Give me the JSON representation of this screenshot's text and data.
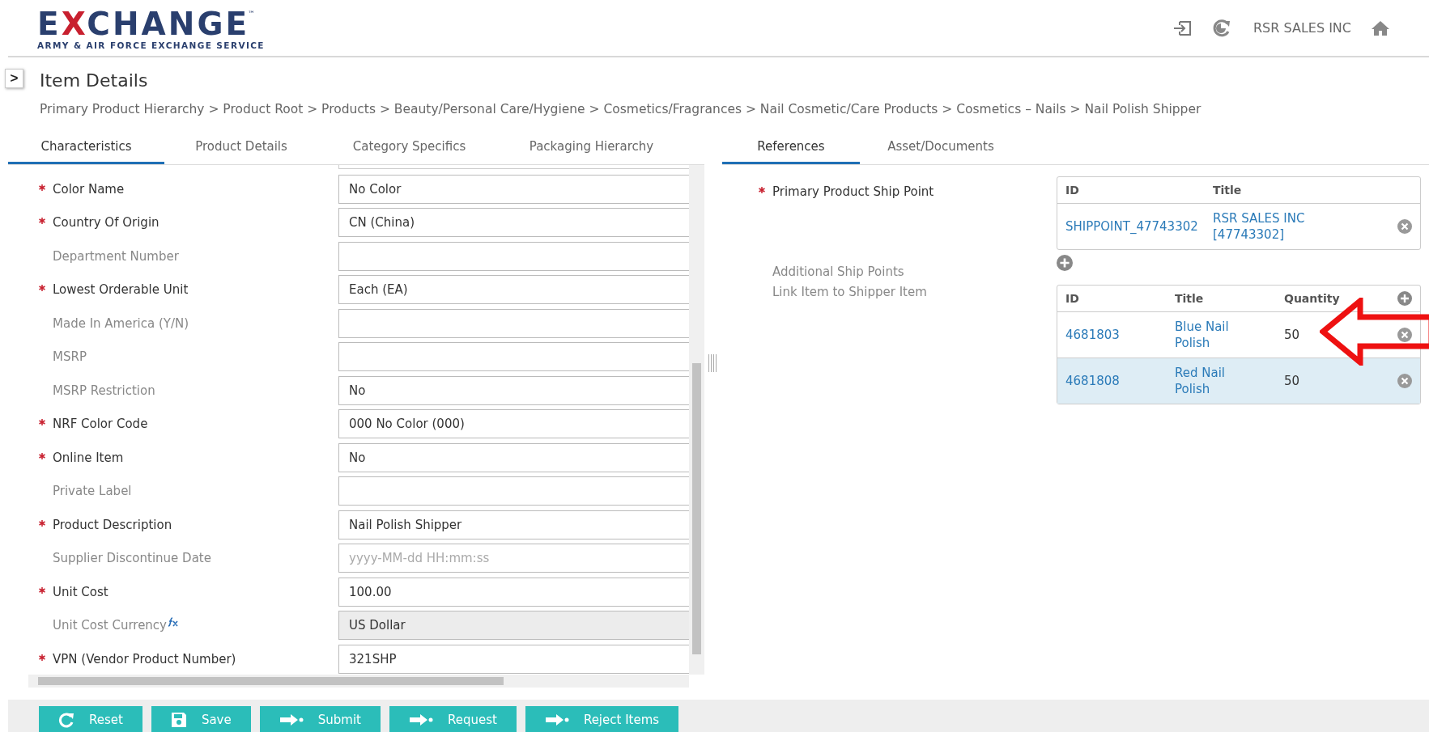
{
  "header": {
    "logo": {
      "lead": "E",
      "accent": "X",
      "rest": "CHANGE",
      "trademark": "™",
      "subtitle": "ARMY & AIR FORCE EXCHANGE SERVICE"
    },
    "user": "RSR SALES INC"
  },
  "sidebar_toggle": ">",
  "page": {
    "title": "Item Details",
    "breadcrumb": "Primary Product Hierarchy > Product Root > Products > Beauty/Personal Care/Hygiene > Cosmetics/Fragrances > Nail Cosmetic/Care Products > Cosmetics – Nails > Nail Polish Shipper"
  },
  "left_tabs": [
    {
      "label": "Characteristics",
      "selected": true
    },
    {
      "label": "Product Details",
      "selected": false
    },
    {
      "label": "Category Specifics",
      "selected": false
    },
    {
      "label": "Packaging Hierarchy",
      "selected": false
    }
  ],
  "fields": [
    {
      "label": "Color Name",
      "required": true,
      "value": "No Color"
    },
    {
      "label": "Country Of Origin",
      "required": true,
      "value": "CN (China)"
    },
    {
      "label": "Department Number",
      "required": false
    },
    {
      "label": "Lowest Orderable Unit",
      "required": true,
      "value": "Each (EA)"
    },
    {
      "label": "Made In America (Y/N)",
      "required": false
    },
    {
      "label": "MSRP",
      "required": false
    },
    {
      "label": "MSRP Restriction",
      "required": false,
      "value": "No"
    },
    {
      "label": "NRF Color Code",
      "required": true,
      "value": "000 No Color (000)"
    },
    {
      "label": "Online Item",
      "required": true,
      "value": "No"
    },
    {
      "label": "Private Label",
      "required": false
    },
    {
      "label": "Product Description",
      "required": true,
      "value": "Nail Polish Shipper"
    },
    {
      "label": "Supplier Discontinue Date",
      "required": false,
      "placeholder": "yyyy-MM-dd HH:mm:ss"
    },
    {
      "label": "Unit Cost",
      "required": true,
      "value": "100.00"
    },
    {
      "label": "Unit Cost Currency",
      "required": false,
      "formula": true,
      "value": "US Dollar",
      "disabled": true
    },
    {
      "label": "VPN (Vendor Product Number)",
      "required": true,
      "value": "321SHP"
    }
  ],
  "right_tabs": [
    {
      "label": "References",
      "selected": true
    },
    {
      "label": "Asset/Documents",
      "selected": false
    }
  ],
  "references": {
    "primary_ship_point": {
      "label": "Primary Product Ship Point",
      "required": true,
      "columns": [
        "ID",
        "Title"
      ],
      "rows": [
        {
          "id": "SHIPPOINT_47743302",
          "title": "RSR SALES INC [47743302]"
        }
      ]
    },
    "additional_ship_points": {
      "label": "Additional Ship Points"
    },
    "shipper_items": {
      "label": "Link Item to Shipper Item",
      "columns": [
        "ID",
        "Title",
        "Quantity"
      ],
      "rows": [
        {
          "id": "4681803",
          "title": "Blue Nail Polish",
          "quantity": "50",
          "selected": false
        },
        {
          "id": "4681808",
          "title": "Red Nail Polish",
          "quantity": "50",
          "selected": true
        }
      ]
    }
  },
  "actions": [
    {
      "label": "Reset",
      "kind": "reset"
    },
    {
      "label": "Save",
      "kind": "save"
    },
    {
      "label": "Submit",
      "kind": "forward"
    },
    {
      "label": "Request",
      "kind": "forward"
    },
    {
      "label": "Reject Items",
      "kind": "forward"
    }
  ]
}
